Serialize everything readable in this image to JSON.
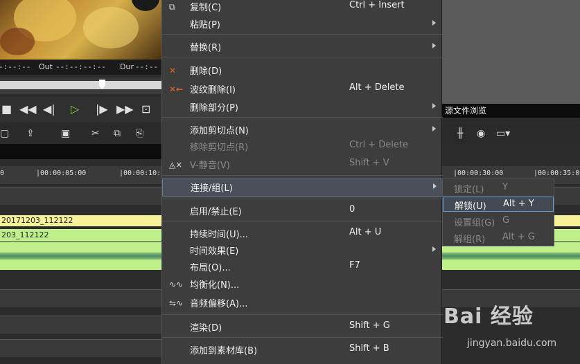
{
  "timecode": {
    "in_tail": "-:--:--",
    "out_label": "Out",
    "out_value": "--:--:--:--",
    "dur_label": "Dur",
    "dur_value": "--:--"
  },
  "right_panel": {
    "file_browser_label": "源文件浏览"
  },
  "ruler": {
    "left_ticks": [
      "0",
      "|00:00:05:00",
      "|00:00:10:"
    ],
    "right_ticks": [
      "|00:00:30:00",
      "|00:00:35:0"
    ]
  },
  "tracks": {
    "clip_yellow": "20171203_112122",
    "clip_green": "203_112122"
  },
  "menu": {
    "items": [
      {
        "label": "复制(C)",
        "shortcut": "Ctrl + Insert",
        "icon": "copy-icon"
      },
      {
        "label": "粘贴(P)",
        "submenu": true
      },
      {
        "label": "替换(R)",
        "submenu": true
      },
      {
        "label": "删除(D)",
        "icon": "delete-x-icon"
      },
      {
        "label": "波纹删除(I)",
        "shortcut": "Alt + Delete",
        "icon": "ripple-delete-icon"
      },
      {
        "label": "删除部分(P)",
        "submenu": true
      },
      {
        "label": "添加剪切点(N)",
        "submenu": true
      },
      {
        "label": "移除剪切点(R)",
        "shortcut": "Ctrl + Delete",
        "disabled": true
      },
      {
        "label": "V-静音(V)",
        "shortcut": "Shift + V",
        "disabled": true,
        "icon": "video-mute-icon"
      },
      {
        "label": "连接/组(L)",
        "submenu": true,
        "highlighted": true
      },
      {
        "label": "启用/禁止(E)",
        "shortcut": "0"
      },
      {
        "label": "持续时间(U)...",
        "shortcut": "Alt + U"
      },
      {
        "label": "时间效果(E)",
        "submenu": true
      },
      {
        "label": "布局(O)...",
        "shortcut": "F7"
      },
      {
        "label": "均衡化(N)...",
        "icon": "normalize-icon"
      },
      {
        "label": "音频偏移(A)...",
        "icon": "audio-offset-icon"
      },
      {
        "label": "渲染(D)",
        "shortcut": "Shift + G"
      },
      {
        "label": "添加到素材库(B)",
        "shortcut": "Shift + B"
      }
    ]
  },
  "submenu": {
    "items": [
      {
        "label": "锁定(L)",
        "shortcut": "Y",
        "disabled": true
      },
      {
        "label": "解锁(U)",
        "shortcut": "Alt + Y",
        "highlighted": true
      },
      {
        "label": "设置组(G)",
        "shortcut": "G",
        "disabled": true
      },
      {
        "label": "解组(R)",
        "shortcut": "Alt + G",
        "disabled": true
      }
    ]
  },
  "watermark": {
    "brand": "Bai 经验",
    "url": "jingyan.baidu.com"
  },
  "colors": {
    "menu_bg": "#3d3d3d",
    "highlight_border": "#6a9bd6",
    "clip_yellow": "#f6f29a",
    "clip_green": "#bff08c",
    "play_green": "#8fd14f",
    "delete_orange": "#e0622a"
  }
}
